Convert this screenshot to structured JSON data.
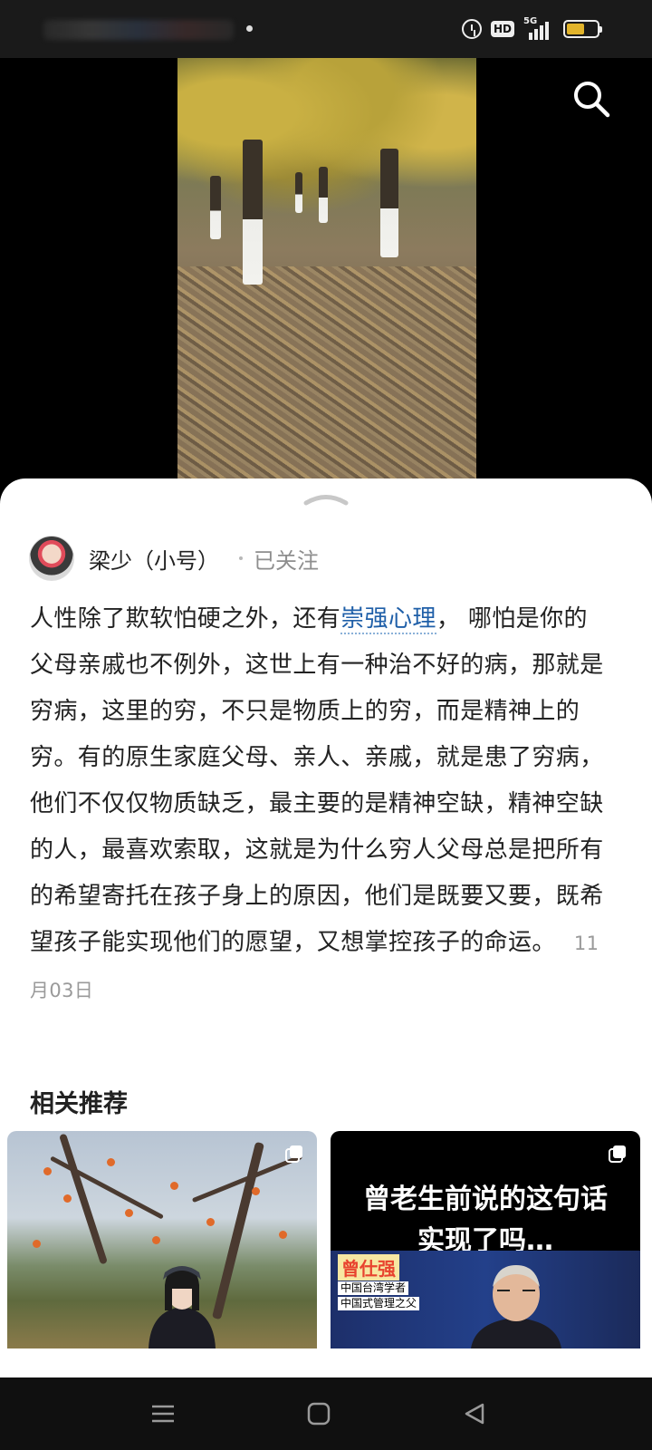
{
  "status_bar": {
    "network": "5G",
    "hd_label": "HD",
    "battery_level": 0.6,
    "icons": [
      "alarm-icon",
      "hd-icon",
      "signal-icon",
      "battery-icon"
    ]
  },
  "video": {
    "search_icon": "search-icon"
  },
  "post": {
    "author_name": "梁少（小号）",
    "follow_status": "已关注",
    "text_before": "人性除了欺软怕硬之外，还有",
    "keyword": "崇强心理",
    "text_after": "， 哪怕是你的父母亲戚也不例外，这世上有一种治不好的病，那就是穷病，这里的穷，不只是物质上的穷，而是精神上的穷。有的原生家庭父母、亲人、亲戚，就是患了穷病，他们不仅仅物质缺乏，最主要的是精神空缺，精神空缺的人，最喜欢索取，这就是为什么穷人父母总是把所有的希望寄托在孩子身上的原因，他们是既要又要，既希望孩子能实现他们的愿望，又想掌控孩子的命运。",
    "date": "11月03日",
    "keyword_color": "#1f5fa8"
  },
  "related": {
    "title": "相关推荐",
    "cards": [
      {
        "overlay_icon": "multi-image-icon"
      },
      {
        "overlay_icon": "multi-image-icon",
        "headline_line1": "曾老生前说的这句话",
        "headline_line2": "实现了吗…",
        "name_tag": "曾仕强",
        "subtitle_1": "中国台湾学者",
        "subtitle_2": "中国式管理之父"
      }
    ]
  },
  "nav_bar": {
    "buttons": [
      "menu-icon",
      "home-icon",
      "back-icon"
    ]
  }
}
